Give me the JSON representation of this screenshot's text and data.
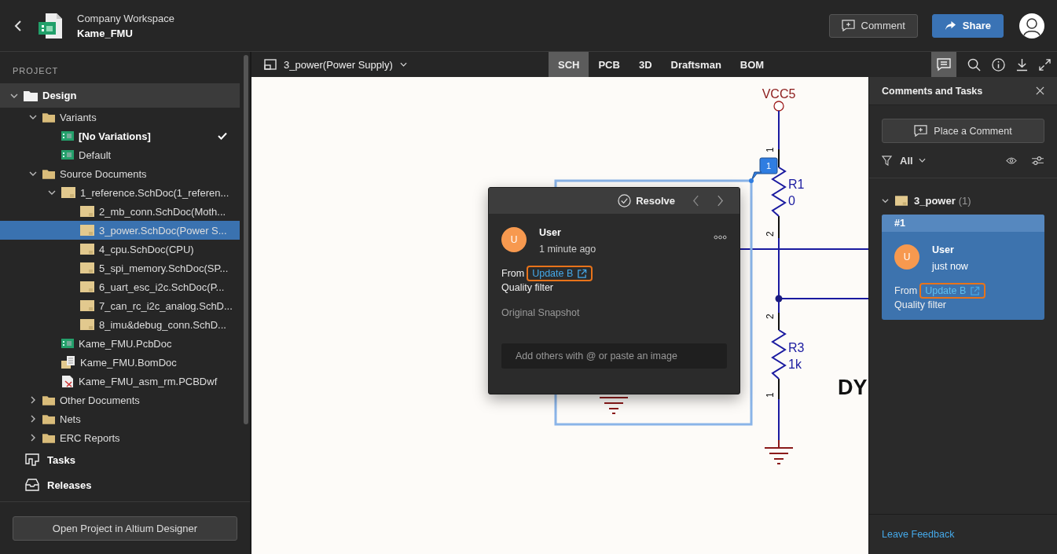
{
  "header": {
    "workspace": "Company Workspace",
    "project": "Kame_FMU",
    "buttons": [
      {
        "label": "Comment",
        "kind": "secondary"
      },
      {
        "label": "Share",
        "kind": "primary"
      }
    ]
  },
  "sidebar": {
    "section_label": "PROJECT",
    "tree": [
      {
        "label": "Design",
        "kind": "root",
        "expanded": true,
        "selected": false,
        "children": [
          {
            "label": "Variants",
            "kind": "folder",
            "expanded": true,
            "selected": false,
            "children": [
              {
                "label": "[No Variations]",
                "kind": "variant",
                "selected": false,
                "checked": true
              },
              {
                "label": "Default",
                "kind": "variant",
                "selected": false,
                "checked": false
              }
            ]
          },
          {
            "label": "Source Documents",
            "kind": "folder",
            "expanded": true,
            "selected": false,
            "children": [
              {
                "label": "1_reference.SchDoc(1_referen...",
                "kind": "sheet",
                "expanded": true,
                "selected": false,
                "children": [
                  {
                    "label": "2_mb_conn.SchDoc(Moth...",
                    "kind": "sheet",
                    "selected": false
                  },
                  {
                    "label": "3_power.SchDoc(Power S...",
                    "kind": "sheet",
                    "selected": true
                  },
                  {
                    "label": "4_cpu.SchDoc(CPU)",
                    "kind": "sheet",
                    "selected": false
                  },
                  {
                    "label": "5_spi_memory.SchDoc(SP...",
                    "kind": "sheet",
                    "selected": false
                  },
                  {
                    "label": "6_uart_esc_i2c.SchDoc(P...",
                    "kind": "sheet",
                    "selected": false
                  },
                  {
                    "label": "7_can_rc_i2c_analog.SchD...",
                    "kind": "sheet",
                    "selected": false
                  },
                  {
                    "label": "8_imu&debug_conn.SchD...",
                    "kind": "sheet",
                    "selected": false
                  }
                ]
              },
              {
                "label": "Kame_FMU.PcbDoc",
                "kind": "pcb",
                "selected": false
              },
              {
                "label": "Kame_FMU.BomDoc",
                "kind": "bom",
                "selected": false
              },
              {
                "label": "Kame_FMU_asm_rm.PCBDwf",
                "kind": "drawing",
                "selected": false
              }
            ]
          },
          {
            "label": "Other Documents",
            "kind": "folder",
            "expanded": false,
            "selected": false
          },
          {
            "label": "Nets",
            "kind": "folder",
            "expanded": false,
            "selected": false
          },
          {
            "label": "ERC Reports",
            "kind": "folder",
            "expanded": false,
            "selected": false
          }
        ]
      }
    ],
    "links": [
      {
        "label": "Tasks",
        "kind": "tasks"
      },
      {
        "label": "Releases",
        "kind": "releases"
      }
    ],
    "open_button": "Open Project in Altium Designer"
  },
  "toolbar": {
    "document": "3_power(Power Supply)",
    "tabs": [
      {
        "label": "SCH",
        "selected": true
      },
      {
        "label": "PCB",
        "selected": false
      },
      {
        "label": "3D",
        "selected": false
      },
      {
        "label": "Draftsman",
        "selected": false
      },
      {
        "label": "BOM",
        "selected": false
      }
    ]
  },
  "schematic": {
    "power_net": "VCC5",
    "components": [
      {
        "ref": "R1",
        "value": "0",
        "pins": [
          "1",
          "2"
        ]
      },
      {
        "ref": "R3",
        "value": "1k",
        "pins": [
          "2",
          "1"
        ]
      }
    ],
    "title_fragment": "DY",
    "marker": "1"
  },
  "comment_popup": {
    "action": "Resolve",
    "avatar": "U",
    "author": "User",
    "time": "1 minute ago",
    "from": "From",
    "link": "Update B",
    "body": "Quality filter",
    "snapshot": "Original Snapshot",
    "reply_placeholder": "Add others with @ or paste an image"
  },
  "comments_panel": {
    "title": "Comments and Tasks",
    "place_button": "Place a Comment",
    "filter": "All",
    "groups": [
      {
        "name": "3_power",
        "count": "(1)",
        "expanded": true,
        "comments": [
          {
            "number": "#1",
            "avatar": "U",
            "author": "User",
            "time": "just now",
            "from": "From",
            "link": "Update B",
            "body": "Quality filter"
          }
        ]
      }
    ],
    "feedback": "Leave Feedback"
  }
}
